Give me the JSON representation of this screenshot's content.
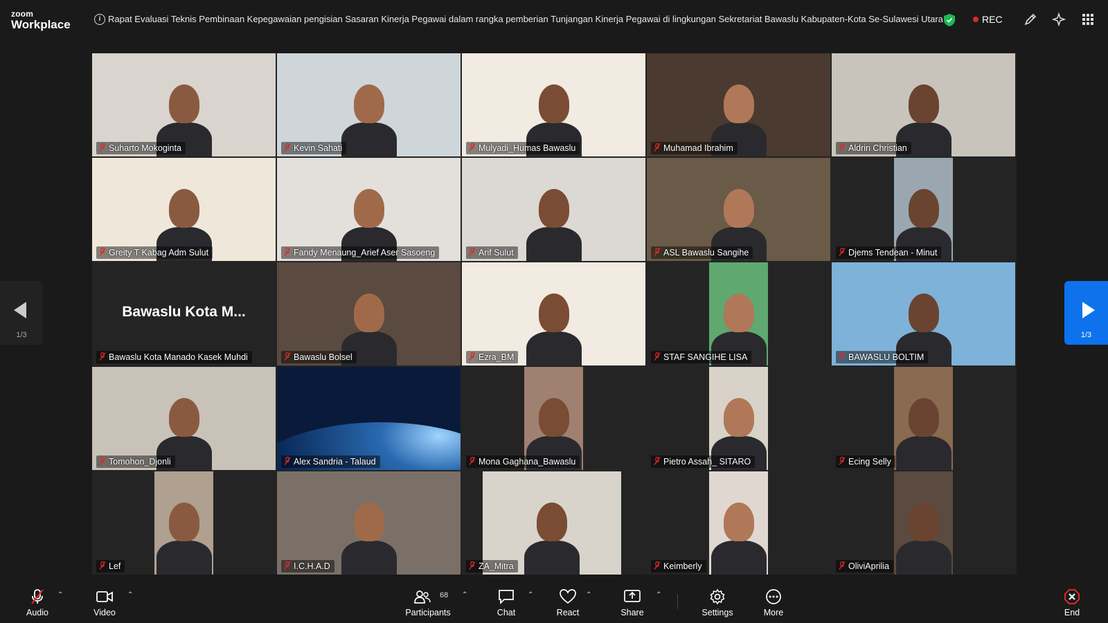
{
  "app": {
    "brand_small": "zoom",
    "brand_big": "Workplace"
  },
  "meeting_title": "Rapat Evaluasi Teknis Pembinaan Kepegawaian pengisian Sasaran Kinerja Pegawai dalam rangka pemberian Tunjangan Kinerja Pegawai di lingkungan Sekretariat Bawaslu Kabupaten-Kota Se-Sulawesi Utara",
  "recording_label": "REC",
  "colors": {
    "active_speaker": "#2cd67a",
    "rec_dot": "#e02828",
    "nav_active": "#0e72ed",
    "end_red": "#e02828"
  },
  "pagination": {
    "left_page": "1/3",
    "right_page": "1/3"
  },
  "tiles": [
    {
      "name": "Suharto Mokoginta",
      "active": false,
      "bg": "#d9d4ce"
    },
    {
      "name": "Kevin Sahati",
      "active": false,
      "bg": "#cfd6da"
    },
    {
      "name": "Mulyadi_Humas Bawaslu",
      "active": false,
      "bg": "#f1ebe2"
    },
    {
      "name": "Muhamad Ibrahim",
      "active": true,
      "bg": "#4a3a30"
    },
    {
      "name": "Aldrin Christian",
      "active": false,
      "bg": "#c9c4bb"
    },
    {
      "name": "Greity T Kabag Adm Sulut",
      "active": false,
      "bg": "#efe7da"
    },
    {
      "name": "Fandy Menaung_Arief Aser Sasoeng",
      "active": false,
      "bg": "#e3e0dc"
    },
    {
      "name": "Arif Sulut",
      "active": false,
      "bg": "#dcd8d4"
    },
    {
      "name": "ASL Bawaslu Sangihe",
      "active": false,
      "bg": "#6a5a48"
    },
    {
      "name": "Djems Tendean - Minut",
      "active": false,
      "bg": "#9aa7b0"
    },
    {
      "name": "Bawaslu Kota Manado Kasek Muhdi",
      "active": false,
      "bg": "#242424",
      "display_text": "Bawaslu Kota M..."
    },
    {
      "name": "Bawaslu Bolsel",
      "active": false,
      "bg": "#5a4a40"
    },
    {
      "name": "Ezra_BM",
      "active": false,
      "bg": "#f1ebe2"
    },
    {
      "name": "STAF SANGIHE LISA",
      "active": false,
      "bg": "#5fa870"
    },
    {
      "name": "BAWASLU BOLTIM",
      "active": false,
      "bg": "#7fb2d8"
    },
    {
      "name": "Tomohon_Djonli",
      "active": false,
      "bg": "#c8c2b8"
    },
    {
      "name": "Alex Sandria - Talaud",
      "active": false,
      "bg": "#0a1a3a"
    },
    {
      "name": "Mona Gaghana_Bawaslu",
      "active": false,
      "bg": "#a08070"
    },
    {
      "name": "Pietro Assah_ SITARO",
      "active": false,
      "bg": "#d8d2c8"
    },
    {
      "name": "Ecing Selly",
      "active": false,
      "bg": "#8a6a50"
    },
    {
      "name": "Lef",
      "active": false,
      "bg": "#b0a090"
    },
    {
      "name": "I.C.H.A.D",
      "active": false,
      "bg": "#7a7068"
    },
    {
      "name": "ZA_Mitra",
      "active": false,
      "bg": "#d8d4cc"
    },
    {
      "name": "Keimberly",
      "active": false,
      "bg": "#e0d8d0"
    },
    {
      "name": "OliviAprilia",
      "active": false,
      "bg": "#5a4a40"
    }
  ],
  "toolbar": {
    "audio": "Audio",
    "video": "Video",
    "participants": "Participants",
    "participant_count": "68",
    "chat": "Chat",
    "react": "React",
    "share": "Share",
    "settings": "Settings",
    "more": "More",
    "end": "End"
  }
}
